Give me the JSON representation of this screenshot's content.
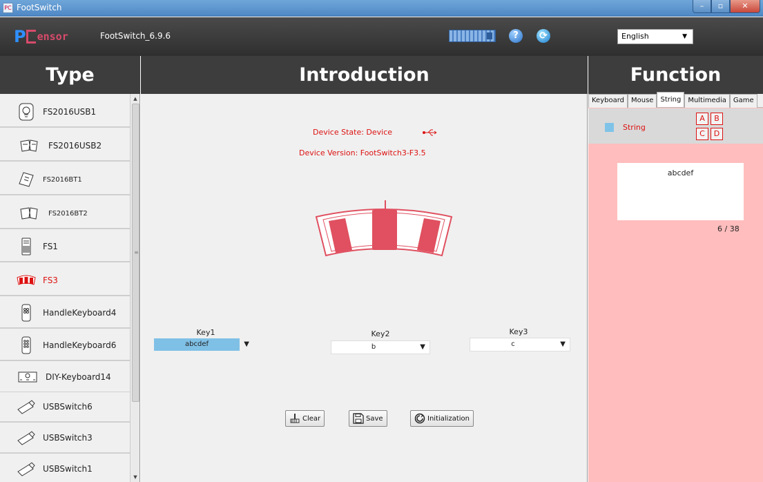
{
  "window": {
    "title": "FootSwitch",
    "app_icon": "PC"
  },
  "header": {
    "version": "FootSwitch_6.9.6",
    "logo_p": "P",
    "logo_rest": "ensor",
    "language": "English"
  },
  "columns": {
    "type": "Type",
    "introduction": "Introduction",
    "function": "Function"
  },
  "sidebar": {
    "items": [
      {
        "label": "FS2016USB1",
        "icon": "bulb-pedal-icon"
      },
      {
        "label": "FS2016USB2",
        "icon": "double-pedal-icon"
      },
      {
        "label": "FS2016BT1",
        "icon": "bt-pedal-icon"
      },
      {
        "label": "FS2016BT2",
        "icon": "bt-double-pedal-icon"
      },
      {
        "label": "FS1",
        "icon": "single-key-icon"
      },
      {
        "label": "FS3",
        "icon": "triple-pedal-icon",
        "active": true
      },
      {
        "label": "HandleKeyboard4",
        "icon": "handle4-icon"
      },
      {
        "label": "HandleKeyboard6",
        "icon": "handle6-icon"
      },
      {
        "label": "DIY-Keyboard14",
        "icon": "diy-keyboard-icon"
      },
      {
        "label": "USBSwitch6",
        "icon": "usb-switch-icon"
      },
      {
        "label": "USBSwitch3",
        "icon": "usb-switch-icon"
      },
      {
        "label": "USBSwitch1",
        "icon": "usb-switch-icon"
      }
    ]
  },
  "intro": {
    "device_state": "Device State:  Device",
    "device_version": "Device Version:   FootSwitch3-F3.5",
    "keys": [
      {
        "label": "Key1",
        "value": "abcdef",
        "selected": true
      },
      {
        "label": "Key2",
        "value": "b"
      },
      {
        "label": "Key3",
        "value": "c"
      }
    ],
    "buttons": {
      "clear": "Clear",
      "save": "Save",
      "initialization": "Initialization"
    }
  },
  "function": {
    "tabs": [
      "Keyboard",
      "Mouse",
      "String",
      "Multimedia",
      "Game"
    ],
    "active_tab": "String",
    "string_label": "String",
    "slots": [
      "A",
      "B",
      "C",
      "D"
    ],
    "string_value": "abcdef",
    "counter": "6 / 38"
  },
  "colors": {
    "accent_red": "#dd1111",
    "pedal_red": "#e05060",
    "panel_pink": "#ffbdbd",
    "header_dark": "#3d3d3d"
  }
}
